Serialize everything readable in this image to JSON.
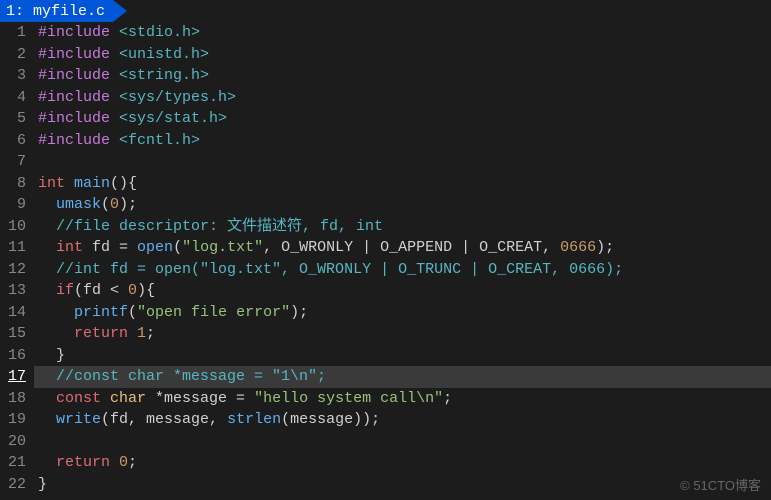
{
  "tab": {
    "label": "1: myfile.c"
  },
  "highlighted_line": 17,
  "watermark": "© 51CTO博客",
  "lines": [
    {
      "n": 1,
      "tokens": [
        [
          "pp",
          "#include "
        ],
        [
          "inc",
          "<stdio.h>"
        ]
      ]
    },
    {
      "n": 2,
      "tokens": [
        [
          "pp",
          "#include "
        ],
        [
          "inc",
          "<unistd.h>"
        ]
      ]
    },
    {
      "n": 3,
      "tokens": [
        [
          "pp",
          "#include "
        ],
        [
          "inc",
          "<string.h>"
        ]
      ]
    },
    {
      "n": 4,
      "tokens": [
        [
          "pp",
          "#include "
        ],
        [
          "inc",
          "<sys/types.h>"
        ]
      ]
    },
    {
      "n": 5,
      "tokens": [
        [
          "pp",
          "#include "
        ],
        [
          "inc",
          "<sys/stat.h>"
        ]
      ]
    },
    {
      "n": 6,
      "tokens": [
        [
          "pp",
          "#include "
        ],
        [
          "inc",
          "<fcntl.h>"
        ]
      ]
    },
    {
      "n": 7,
      "tokens": []
    },
    {
      "n": 8,
      "tokens": [
        [
          "kw",
          "int "
        ],
        [
          "fn",
          "main"
        ],
        [
          "op",
          "(){"
        ]
      ]
    },
    {
      "n": 9,
      "tokens": [
        [
          "op",
          "  "
        ],
        [
          "fn",
          "umask"
        ],
        [
          "op",
          "("
        ],
        [
          "num",
          "0"
        ],
        [
          "op",
          ");"
        ]
      ]
    },
    {
      "n": 10,
      "tokens": [
        [
          "op",
          "  "
        ],
        [
          "cmt",
          "//file descriptor: 文件描述符, fd, int"
        ]
      ]
    },
    {
      "n": 11,
      "tokens": [
        [
          "op",
          "  "
        ],
        [
          "kw",
          "int "
        ],
        [
          "op",
          "fd = "
        ],
        [
          "fn",
          "open"
        ],
        [
          "op",
          "("
        ],
        [
          "str",
          "\"log.txt\""
        ],
        [
          "op",
          ", O_WRONLY | O_APPEND | O_CREAT, "
        ],
        [
          "num",
          "0666"
        ],
        [
          "op",
          ");"
        ]
      ]
    },
    {
      "n": 12,
      "tokens": [
        [
          "op",
          "  "
        ],
        [
          "cmt",
          "//int fd = open(\"log.txt\", O_WRONLY | O_TRUNC | O_CREAT, 0666);"
        ]
      ]
    },
    {
      "n": 13,
      "tokens": [
        [
          "op",
          "  "
        ],
        [
          "kw",
          "if"
        ],
        [
          "op",
          "(fd < "
        ],
        [
          "num",
          "0"
        ],
        [
          "op",
          "){"
        ]
      ]
    },
    {
      "n": 14,
      "tokens": [
        [
          "op",
          "    "
        ],
        [
          "fn",
          "printf"
        ],
        [
          "op",
          "("
        ],
        [
          "str",
          "\"open file error\""
        ],
        [
          "op",
          ");"
        ]
      ]
    },
    {
      "n": 15,
      "tokens": [
        [
          "op",
          "    "
        ],
        [
          "kw",
          "return "
        ],
        [
          "num",
          "1"
        ],
        [
          "op",
          ";"
        ]
      ]
    },
    {
      "n": 16,
      "tokens": [
        [
          "op",
          "  }"
        ]
      ]
    },
    {
      "n": 17,
      "tokens": [
        [
          "op",
          "  "
        ],
        [
          "cmt",
          "//const char *message = \"1\\n\";"
        ]
      ]
    },
    {
      "n": 18,
      "tokens": [
        [
          "op",
          "  "
        ],
        [
          "kw",
          "const "
        ],
        [
          "type",
          "char "
        ],
        [
          "op",
          "*message = "
        ],
        [
          "str",
          "\"hello system call\\n\""
        ],
        [
          "op",
          ";"
        ]
      ]
    },
    {
      "n": 19,
      "tokens": [
        [
          "op",
          "  "
        ],
        [
          "fn",
          "write"
        ],
        [
          "op",
          "(fd, message, "
        ],
        [
          "fn",
          "strlen"
        ],
        [
          "op",
          "(message));"
        ]
      ]
    },
    {
      "n": 20,
      "tokens": []
    },
    {
      "n": 21,
      "tokens": [
        [
          "op",
          "  "
        ],
        [
          "kw",
          "return "
        ],
        [
          "num",
          "0"
        ],
        [
          "op",
          ";"
        ]
      ]
    },
    {
      "n": 22,
      "tokens": [
        [
          "op",
          "}"
        ]
      ]
    }
  ]
}
